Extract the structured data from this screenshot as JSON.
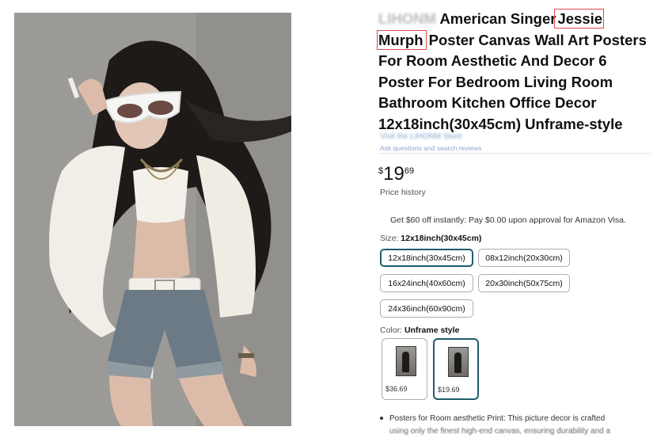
{
  "product": {
    "brand": "LIHONM",
    "title_before": "American Singer",
    "title_highlight": "Jessie Murph",
    "title_after": "Poster Canvas Wall Art Posters For Room Aesthetic And Decor 6 Poster For Bedroom Living Room Bathroom Kitchen Office Decor 12x18inch(30x45cm) Unframe-style",
    "store_link": "Visit the LIHONM Store",
    "search_note": "Ask questions and search reviews"
  },
  "price": {
    "symbol": "$",
    "whole": "19",
    "fraction": "69",
    "history_label": "Price history"
  },
  "offer": {
    "text": "Get $60 off instantly: Pay $0.00 upon approval for Amazon Visa."
  },
  "size": {
    "label": "Size:",
    "selected": "12x18inch(30x45cm)",
    "options": [
      "12x18inch(30x45cm)",
      "08x12inch(20x30cm)",
      "16x24inch(40x60cm)",
      "20x30inch(50x75cm)",
      "24x36inch(60x90cm)"
    ]
  },
  "color": {
    "label": "Color:",
    "selected": "Unframe style",
    "swatches": [
      {
        "price": "$36.69"
      },
      {
        "price": "$19.69"
      }
    ]
  },
  "bullets": [
    "Posters for Room aesthetic Print: This picture decor is crafted",
    "using only the finest high-end canvas, ensuring durability and a"
  ],
  "colors": {
    "selected_border": "#1f5c6b",
    "highlight_box": "#e04848",
    "link": "#1b6fb3"
  }
}
